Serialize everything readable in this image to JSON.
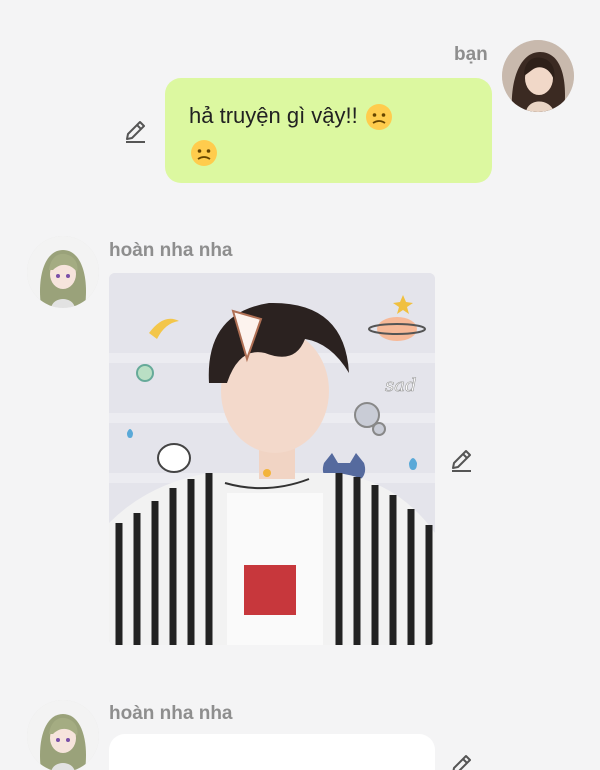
{
  "messages": [
    {
      "sender": "bạn",
      "text": "hả truyện gì vậy!!",
      "emoji": [
        "🫤",
        "🫤"
      ]
    },
    {
      "sender": "hoàn nha nha",
      "photo_sticker_text": "sad"
    },
    {
      "sender": "hoàn nha nha",
      "text": ""
    }
  ],
  "colors": {
    "outgoing_bubble": "#dcf8a0",
    "background": "#f4f4f5",
    "name_text": "#8e8e8e"
  },
  "icons": [
    "pencil-edit-icon"
  ]
}
